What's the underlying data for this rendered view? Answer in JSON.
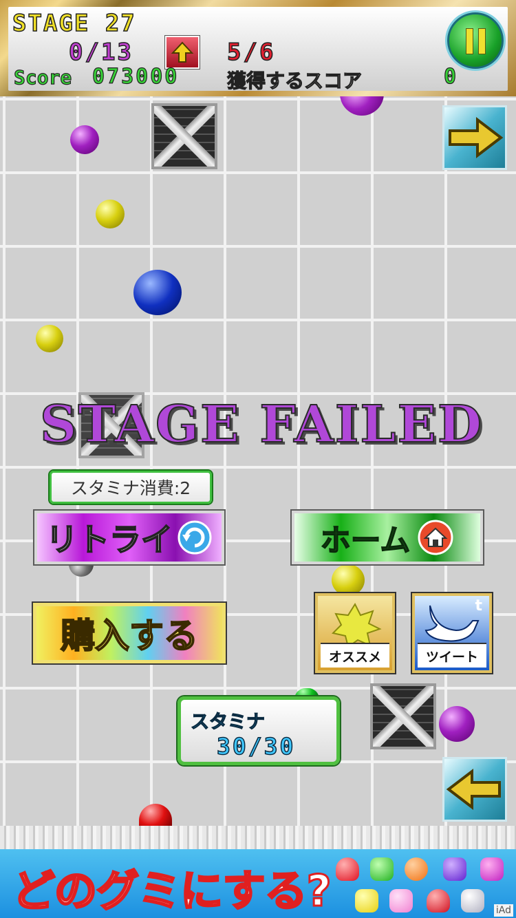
{
  "hud": {
    "stage": "STAGE 27",
    "progress": "0/13",
    "moves": "5/6",
    "score_label": "Score",
    "score": "073000",
    "gain_label": "獲得するスコア",
    "gain_value": "0"
  },
  "overlay": {
    "title": "STAGE  FAILED",
    "stamina_cost": "スタミナ消費:2",
    "retry_label": "リトライ",
    "home_label": "ホーム",
    "buy_label": "購入する",
    "osusume_label": "オススメ",
    "tweet_label": "ツイート",
    "tweet_badge": "t",
    "stamina_label": "スタミナ",
    "stamina_value": "30/30"
  },
  "ad": {
    "text": "どのグミにする?",
    "badge": "iAd"
  },
  "colors": {
    "accent_purple": "#b048d8",
    "accent_green": "#38d038",
    "accent_yellow": "#f0e028"
  }
}
